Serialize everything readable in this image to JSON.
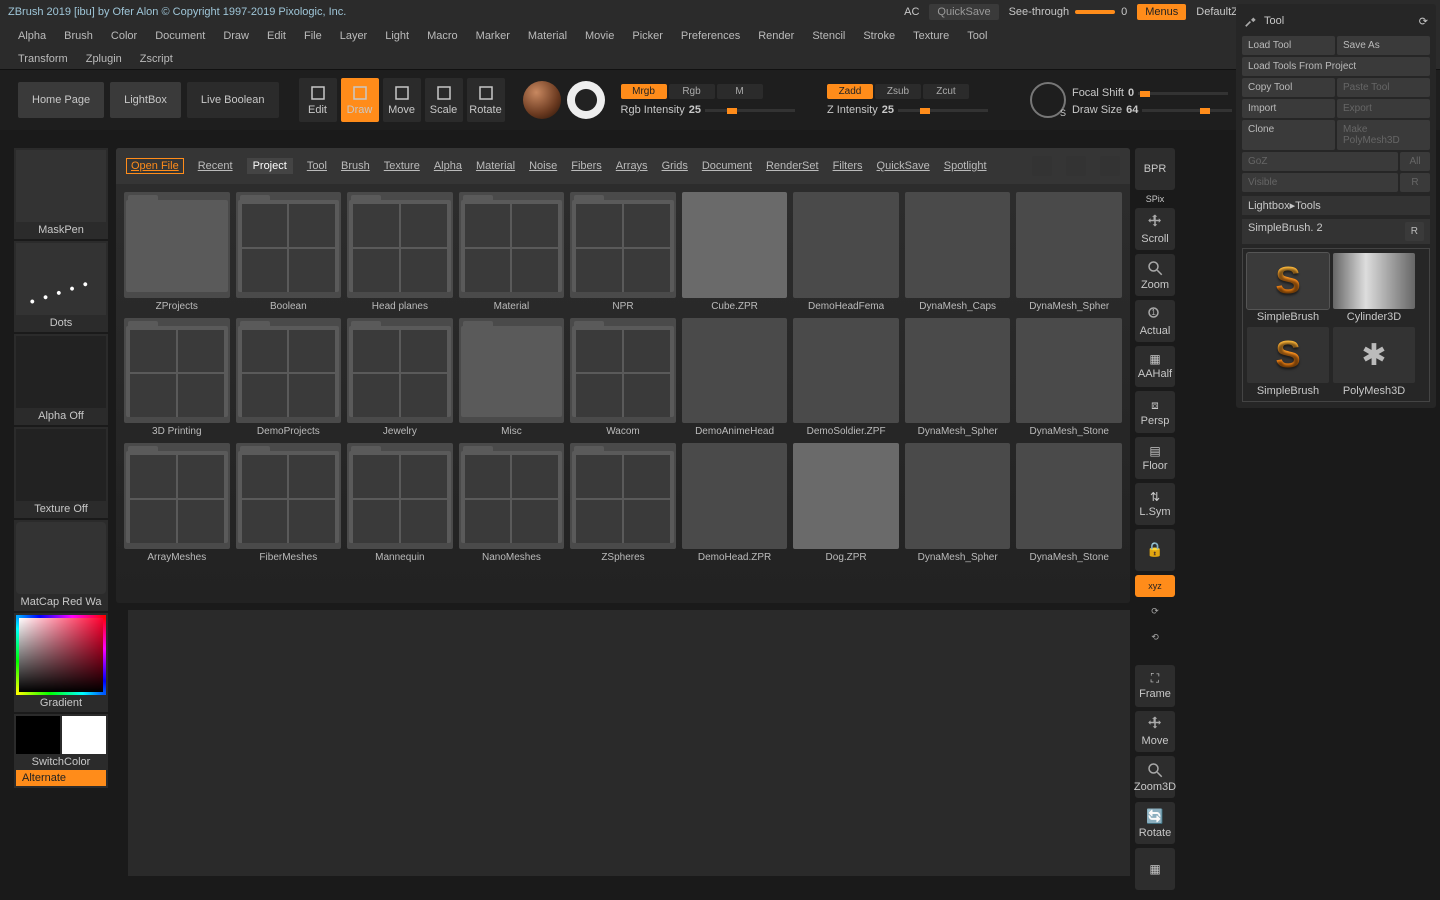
{
  "title": "ZBrush 2019 [ibu] by Ofer Alon © Copyright 1997-2019 Pixologic, Inc.",
  "top": {
    "ac": "AC",
    "quicksave": "QuickSave",
    "see_through": "See-through",
    "see_val": "0",
    "menus": "Menus",
    "script": "DefaultZScript"
  },
  "menu": [
    "Alpha",
    "Brush",
    "Color",
    "Document",
    "Draw",
    "Edit",
    "File",
    "Layer",
    "Light",
    "Macro",
    "Marker",
    "Material",
    "Movie",
    "Picker",
    "Preferences",
    "Render",
    "Stencil",
    "Stroke",
    "Texture",
    "Tool"
  ],
  "menu2": [
    "Transform",
    "Zplugin",
    "Zscript"
  ],
  "toolbar": {
    "home": "Home Page",
    "lightbox": "LightBox",
    "livebool": "Live Boolean",
    "modes": [
      {
        "l": "Edit"
      },
      {
        "l": "Draw",
        "active": true
      },
      {
        "l": "Move"
      },
      {
        "l": "Scale"
      },
      {
        "l": "Rotate"
      }
    ],
    "row1": [
      {
        "l": "Mrgb",
        "a": true
      },
      {
        "l": "Rgb"
      },
      {
        "l": "M"
      }
    ],
    "row2": [
      {
        "l": "Zadd",
        "a": true
      },
      {
        "l": "Zsub"
      },
      {
        "l": "Zcut"
      }
    ],
    "rgb_int_l": "Rgb Intensity",
    "rgb_int_v": "25",
    "z_int_l": "Z Intensity",
    "z_int_v": "25",
    "focal_l": "Focal Shift",
    "focal_v": "0",
    "draw_l": "Draw Size",
    "draw_v": "64"
  },
  "left": {
    "mask": "MaskPen",
    "dots": "Dots",
    "alpha": "Alpha Off",
    "tex": "Texture Off",
    "mat": "MatCap Red Wa",
    "grad": "Gradient",
    "switch": "SwitchColor",
    "alt": "Alternate"
  },
  "browser": {
    "open": "Open File",
    "tabs": [
      "Recent",
      "Project",
      "Tool",
      "Brush",
      "Texture",
      "Alpha",
      "Material",
      "Noise",
      "Fibers",
      "Arrays",
      "Grids",
      "Document",
      "RenderSet",
      "Filters",
      "QuickSave",
      "Spotlight"
    ],
    "sel": "Project",
    "items": [
      {
        "l": "ZProjects",
        "k": "folder"
      },
      {
        "l": "Boolean",
        "k": "quad"
      },
      {
        "l": "Head planes",
        "k": "quad"
      },
      {
        "l": "Material",
        "k": "quad"
      },
      {
        "l": "NPR",
        "k": "quad"
      },
      {
        "l": "Cube.ZPR",
        "k": "plain"
      },
      {
        "l": "DemoHeadFema",
        "k": "head"
      },
      {
        "l": "DynaMesh_Caps",
        "k": "cyl"
      },
      {
        "l": "DynaMesh_Spher",
        "k": "sphere"
      },
      {
        "l": "3D Printing",
        "k": "quad"
      },
      {
        "l": "DemoProjects",
        "k": "quad"
      },
      {
        "l": "Jewelry",
        "k": "quad"
      },
      {
        "l": "Misc",
        "k": "folder"
      },
      {
        "l": "Wacom",
        "k": "quad"
      },
      {
        "l": "DemoAnimeHead",
        "k": "head"
      },
      {
        "l": "DemoSoldier.ZPF",
        "k": "head"
      },
      {
        "l": "DynaMesh_Spher",
        "k": "sphere"
      },
      {
        "l": "DynaMesh_Stone",
        "k": "stone"
      },
      {
        "l": "ArrayMeshes",
        "k": "quad"
      },
      {
        "l": "FiberMeshes",
        "k": "quad"
      },
      {
        "l": "Mannequin",
        "k": "quad"
      },
      {
        "l": "NanoMeshes",
        "k": "quad"
      },
      {
        "l": "ZSpheres",
        "k": "quad"
      },
      {
        "l": "DemoHead.ZPR",
        "k": "head"
      },
      {
        "l": "Dog.ZPR",
        "k": "plain"
      },
      {
        "l": "DynaMesh_Spher",
        "k": "sphere"
      },
      {
        "l": "DynaMesh_Stone",
        "k": "stone"
      }
    ]
  },
  "rtcol": {
    "bpr": "BPR",
    "spix": "SPix",
    "scroll": "Scroll",
    "zoom": "Zoom",
    "actual": "Actual",
    "aahalf": "AAHalf",
    "persp": "Persp",
    "floor": "Floor",
    "lsym": "L.Sym",
    "xyz": "xyz",
    "frame": "Frame",
    "move": "Move",
    "zoom3d": "Zoom3D",
    "rotate": "Rotate"
  },
  "toolpanel": {
    "hdr": "Tool",
    "buttons": [
      {
        "l": "Load Tool"
      },
      {
        "l": "Save As"
      },
      {
        "l": "Load Tools From Project",
        "wide": true
      },
      {
        "l": "Copy Tool"
      },
      {
        "l": "Paste Tool",
        "dim": true
      },
      {
        "l": "Import"
      },
      {
        "l": "Export",
        "dim": true
      },
      {
        "l": "Clone"
      },
      {
        "l": "Make PolyMesh3D",
        "dim": true
      },
      {
        "l": "GoZ",
        "dim": true
      },
      {
        "l": "All",
        "dim": true,
        "sm": true
      },
      {
        "l": "Visible",
        "dim": true
      },
      {
        "l": "R",
        "dim": true,
        "sm": true
      }
    ],
    "crumb": "Lightbox▸Tools",
    "cur": "SimpleBrush.",
    "cur_n": "2",
    "cur_r": "R",
    "thumbs": [
      {
        "l": "SimpleBrush",
        "sel": true,
        "k": "s"
      },
      {
        "l": "Cylinder3D",
        "k": "cyl"
      },
      {
        "l": "SimpleBrush",
        "k": "s"
      },
      {
        "l": "PolyMesh3D",
        "k": "star"
      }
    ]
  }
}
